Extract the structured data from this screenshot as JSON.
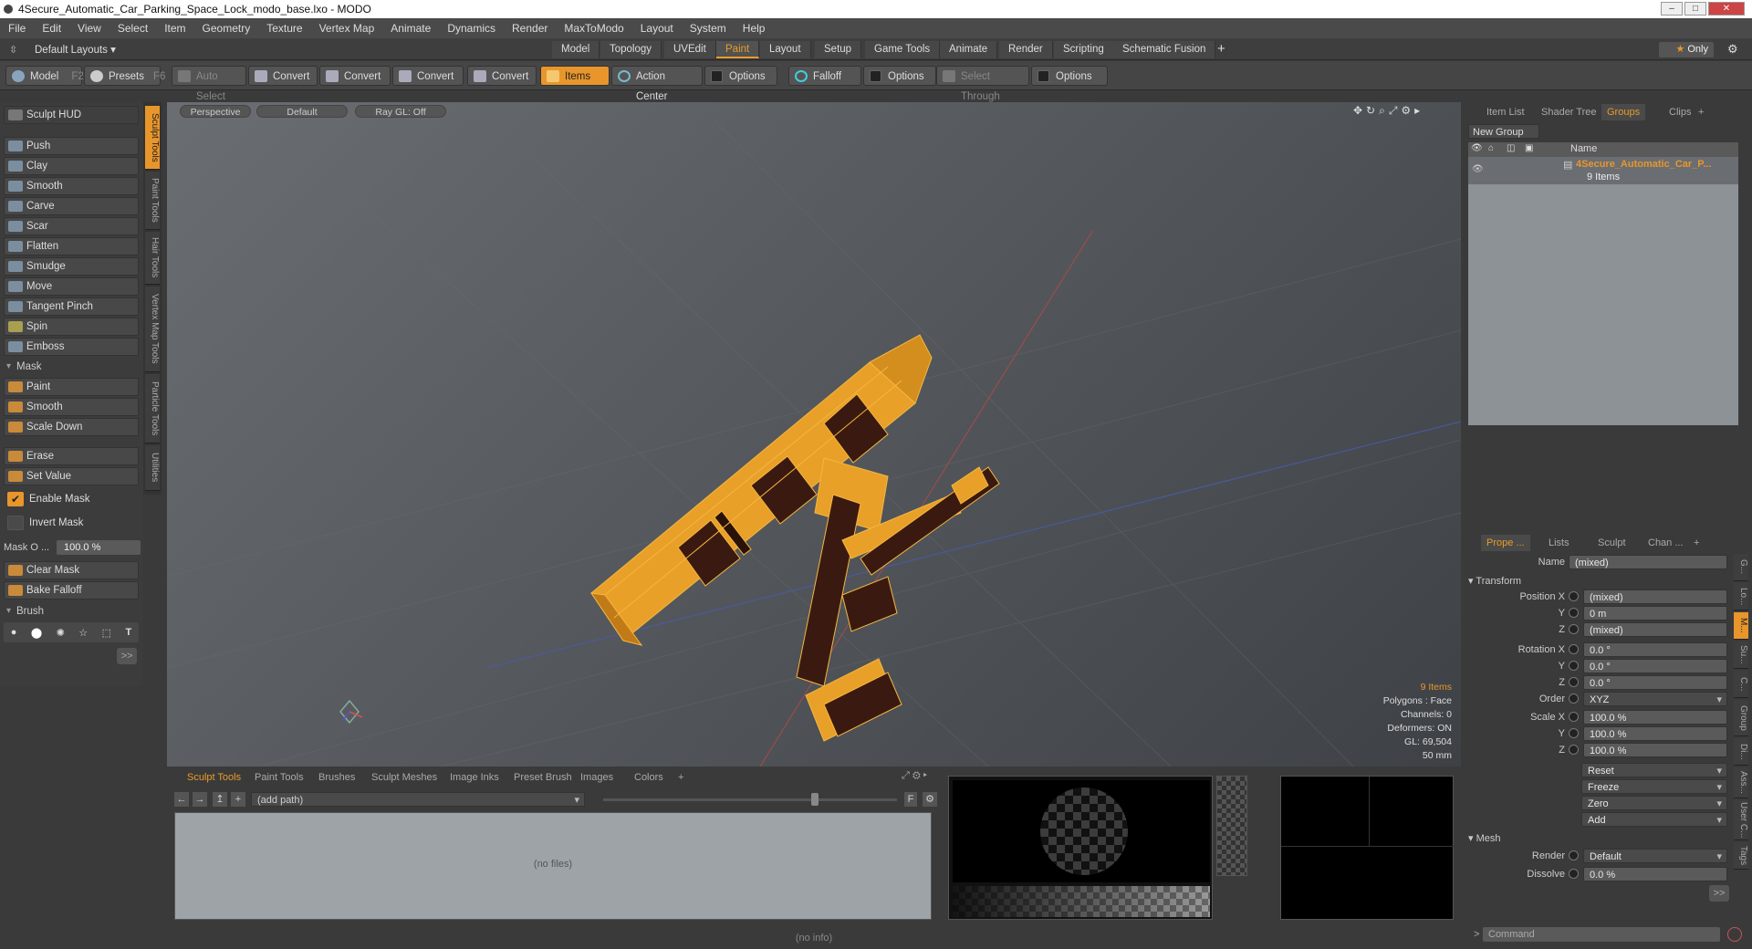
{
  "window": {
    "title": "4Secure_Automatic_Car_Parking_Space_Lock_modo_base.lxo - MODO",
    "min": "–",
    "max": "□",
    "close": "✕"
  },
  "menu": [
    "File",
    "Edit",
    "View",
    "Select",
    "Item",
    "Geometry",
    "Texture",
    "Vertex Map",
    "Animate",
    "Dynamics",
    "Render",
    "MaxToModo",
    "Layout",
    "System",
    "Help"
  ],
  "layoutbar": {
    "layout_select": "Default Layouts ▾",
    "tabs": [
      "Model",
      "Topology",
      "UVEdit",
      "Paint",
      "Layout",
      "Setup",
      "Game Tools",
      "Animate",
      "Render",
      "Scripting",
      "Schematic Fusion",
      "+"
    ],
    "active_tab": "Paint",
    "only": "Only"
  },
  "toolbar": {
    "model": "Model",
    "model_key": "F2",
    "presets": "Presets",
    "presets_key": "F6",
    "auto_select": "Auto Select",
    "convert1": "Convert",
    "convert2": "Convert",
    "convert3": "Convert",
    "convert4": "Convert",
    "items": "Items",
    "action_center": "Action Center",
    "options1": "Options",
    "falloff": "Falloff",
    "options2": "Options",
    "select_through": "Select Through",
    "options3": "Options"
  },
  "sculpt": {
    "hud": "Sculpt HUD",
    "tools": [
      "Push",
      "Clay",
      "Smooth",
      "Carve",
      "Scar",
      "Flatten",
      "Smudge",
      "Move",
      "Tangent Pinch",
      "Spin",
      "Emboss"
    ],
    "mask_header": "Mask",
    "mask_tools": [
      "Paint",
      "Smooth",
      "Scale Down"
    ],
    "erase": "Erase",
    "set_value": "Set Value",
    "enable_mask": "Enable Mask",
    "invert_mask": "Invert Mask",
    "mask_opacity_label": "Mask O ...",
    "mask_opacity_value": "100.0 %",
    "clear_mask": "Clear Mask",
    "bake_falloff": "Bake Falloff",
    "brush_header": "Brush",
    "more": ">>"
  },
  "vertical_tabs": [
    "Sculpt Tools",
    "Paint Tools",
    "Hair Tools",
    "Vertex Map Tools",
    "Particle Tools",
    "Utilities"
  ],
  "viewport": {
    "view": "Perspective",
    "shading": "Default",
    "raygl": "Ray GL: Off",
    "stats": [
      "9 Items",
      "Polygons : Face",
      "Channels: 0",
      "Deformers: ON",
      "GL: 69,504",
      "50 mm"
    ]
  },
  "bottom": {
    "tabs": [
      "Sculpt Tools",
      "Paint Tools",
      "Brushes",
      "Sculpt Meshes",
      "Image Inks",
      "Preset Brush",
      "Images",
      "Colors",
      "+"
    ],
    "path": "(add path)",
    "nofiles": "(no files)",
    "f_btn": "F"
  },
  "status": "(no info)",
  "right": {
    "top_tabs": [
      "Item List",
      "Shader Tree",
      "Groups",
      "Clips",
      "+"
    ],
    "new_group": "New Group",
    "col_name": "Name",
    "group_name": "4Secure_Automatic_Car_P...",
    "group_count": "9 Items",
    "prop_tabs": [
      "Prope ...",
      "Lists",
      "Sculpt",
      "Chan ...",
      "+"
    ],
    "name_label": "Name",
    "name_value": "(mixed)",
    "transform": "Transform",
    "position_x_label": "Position X",
    "position_x": "(mixed)",
    "position_y": "0 m",
    "position_z": "(mixed)",
    "rotation_x_label": "Rotation X",
    "rotation_x": "0.0 °",
    "rotation_y": "0.0 °",
    "rotation_z": "0.0 °",
    "order_label": "Order",
    "order": "XYZ",
    "scale_x_label": "Scale X",
    "scale_x": "100.0 %",
    "scale_y": "100.0 %",
    "scale_z": "100.0 %",
    "y_label": "Y",
    "z_label": "Z",
    "reset": "Reset",
    "freeze": "Freeze",
    "zero": "Zero",
    "add": "Add",
    "mesh": "Mesh",
    "render_label": "Render",
    "render_value": "Default",
    "dissolve_label": "Dissolve",
    "dissolve_value": "0.0 %",
    "more": ">>",
    "command": "Command",
    "side_tabs": [
      "G...",
      "Lo...",
      "M...",
      "Su...",
      "C...",
      "Group",
      "Di...",
      "Ass...",
      "User C...",
      "Tags"
    ]
  },
  "colors": {
    "accent": "#e8962b",
    "object": "#f0a020",
    "stripe": "#3a1a10"
  }
}
